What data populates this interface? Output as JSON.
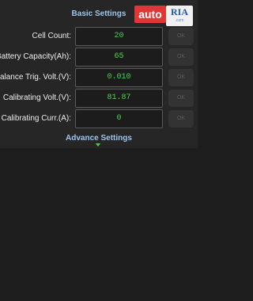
{
  "basic_settings": {
    "title": "Basic Settings"
  },
  "rows": [
    {
      "label": "Cell Count:",
      "value": "20",
      "ok": "OK"
    },
    {
      "label": "Battery Capacity(Ah):",
      "value": "65",
      "ok": "OK"
    },
    {
      "label": "Balance Trig. Volt.(V):",
      "value": "0.010",
      "ok": "OK"
    },
    {
      "label": "Calibrating Volt.(V):",
      "value": "81.87",
      "ok": "OK"
    },
    {
      "label": "Calibrating Curr.(A):",
      "value": "0",
      "ok": "OK"
    }
  ],
  "advance_settings": {
    "label": "Advance Settings"
  },
  "watermark": {
    "brand_left": "auto",
    "brand_right": "RIA",
    "sub": ".com"
  },
  "colors": {
    "value_text": "#4dd24d",
    "section_title": "#9ec5ee",
    "panel_bg": "#262626",
    "page_bg": "#1e1e1e"
  }
}
